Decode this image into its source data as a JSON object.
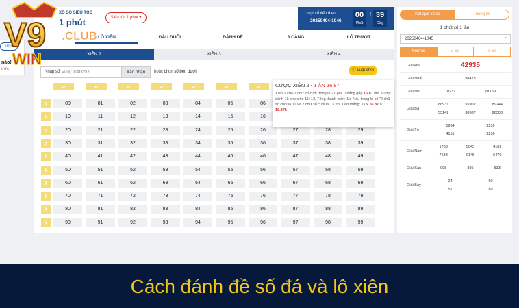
{
  "brand": {
    "logo_text": "V9",
    "logo_sub": "WIN",
    "logo_club": ".CLUB",
    "accent": "#f4c51b",
    "primary": "#1d4e91",
    "secondary": "#f39c4a"
  },
  "left_stub": {
    "button_label": "ược",
    "line1": "nào!",
    "line2": "ược"
  },
  "header": {
    "small_title": "XỔ SỐ SIÊU TỐC",
    "big_title": "1 phút",
    "speed_select": "Siêu tốc 1 phút ▾"
  },
  "timer": {
    "label": "Lượt xổ tiếp theo",
    "draw_id": "20250404-1046",
    "minutes": "00",
    "minutes_unit": "Phút",
    "seconds": "39",
    "seconds_unit": "Giây"
  },
  "tabs": [
    "LÔ XIÊN",
    "ĐẦU ĐUÔI",
    "ĐÁNH ĐỀ",
    "3 CÀNG",
    "LÔ TRƯỢT"
  ],
  "subtabs": [
    "XIÊN 2",
    "XIÊN 3",
    "XIÊN 4"
  ],
  "input": {
    "label": "Nhập số",
    "placeholder": "Ví dụ: 8383237",
    "confirm": "Xác nhận",
    "or_prefix": "hoặc",
    "or_link": "chọn số bên dưới",
    "rules": "Luật chơi"
  },
  "grid_rows": [
    [
      "00",
      "01",
      "02",
      "03",
      "04",
      "05",
      "06",
      "07",
      "08",
      "09"
    ],
    [
      "10",
      "11",
      "12",
      "13",
      "14",
      "15",
      "16",
      "17",
      "18",
      "19"
    ],
    [
      "20",
      "21",
      "22",
      "23",
      "24",
      "25",
      "26",
      "27",
      "28",
      "29"
    ],
    [
      "30",
      "31",
      "32",
      "33",
      "34",
      "35",
      "36",
      "37",
      "38",
      "39"
    ],
    [
      "40",
      "41",
      "42",
      "43",
      "44",
      "45",
      "46",
      "47",
      "48",
      "49"
    ],
    [
      "50",
      "51",
      "52",
      "53",
      "54",
      "55",
      "56",
      "57",
      "58",
      "59"
    ],
    [
      "60",
      "61",
      "62",
      "63",
      "64",
      "65",
      "66",
      "67",
      "68",
      "69"
    ],
    [
      "70",
      "71",
      "72",
      "73",
      "74",
      "75",
      "76",
      "77",
      "78",
      "79"
    ],
    [
      "80",
      "81",
      "82",
      "83",
      "84",
      "85",
      "86",
      "87",
      "88",
      "89"
    ],
    [
      "90",
      "91",
      "92",
      "93",
      "94",
      "95",
      "96",
      "97",
      "98",
      "99"
    ]
  ],
  "tooltip": {
    "title": "CƯỢC XIÊN 2 - ",
    "title_red": "1 ĂN 16.87",
    "body1": "Xiên 2 của 2 chữ số cuối trong lô 27 giải. Thắng gấp ",
    "body_red1": "16.87",
    "body2": " lần. Ví dụ: đánh 1k cho xiên 11+13, Tổng thanh toán: 1k. Nếu trong lô có \"2 chữ số cuối là 11 và 2 chữ số cuối là 13\" thì Tiền thắng: 1k x ",
    "body_red2": "16.87",
    "body3": " = ",
    "body_red3": "16.87k"
  },
  "results": {
    "tab_active": "Kết quả xổ số",
    "tab_other": "Thống kê",
    "draw_title": "1 phút xổ 1 lần",
    "draw_select": "20250404-1045",
    "modes": [
      "Normal",
      "2 Số",
      "3 Số"
    ],
    "prizes": [
      {
        "name": "Giải ĐB",
        "values": [
          "42935"
        ]
      },
      {
        "name": "Giải Nhất",
        "values": [
          "98473"
        ]
      },
      {
        "name": "Giải Nhì",
        "values": [
          "70237",
          "81169"
        ]
      },
      {
        "name": "Giải Ba",
        "values": [
          "88931",
          "55902",
          "89244",
          "53142",
          "38987",
          "26308"
        ]
      },
      {
        "name": "Giải Tư",
        "values": [
          "1964",
          "2239",
          "4151",
          "2236"
        ]
      },
      {
        "name": "Giải Năm",
        "values": [
          "1763",
          "5045",
          "4102",
          "7688",
          "0145",
          "5479"
        ]
      },
      {
        "name": "Giải Sáu",
        "values": [
          "008",
          "395",
          "833"
        ]
      },
      {
        "name": "Giải Bảy",
        "values": [
          "24",
          "60",
          "51",
          "89"
        ]
      }
    ]
  },
  "caption": "Cách đánh đề số đá và lô xiên"
}
